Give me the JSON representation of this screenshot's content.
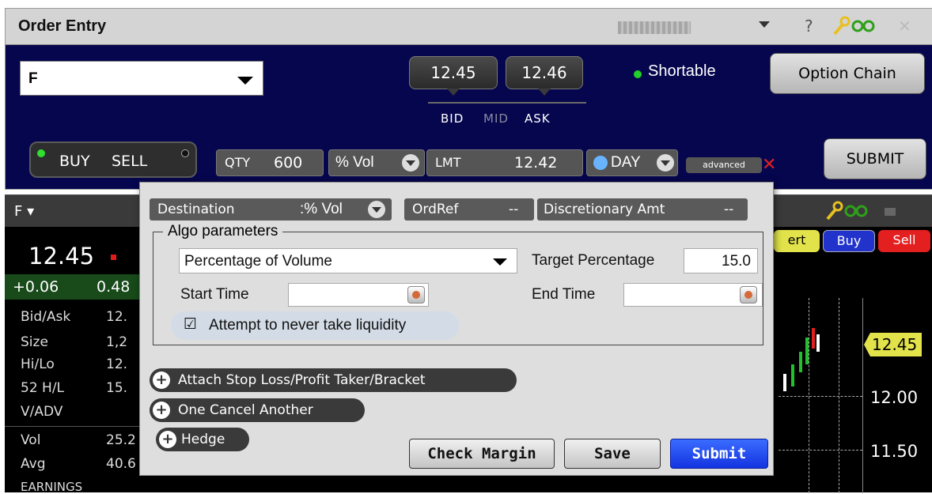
{
  "order_entry": {
    "title": "Order Entry",
    "symbol": "F",
    "bid": "12.45",
    "ask": "12.46",
    "bid_label": "BID",
    "mid_label": "MID",
    "ask_label": "ASK",
    "shortable": "Shortable",
    "option_chain": "Option Chain",
    "buy": "BUY",
    "sell": "SELL",
    "qty_label": "QTY",
    "qty_value": "600",
    "algo_type": "% Vol",
    "order_type": "LMT",
    "limit_price": "12.42",
    "tif": "DAY",
    "advanced": "advanced",
    "submit": "SUBMIT",
    "help": "?"
  },
  "quote_panel": {
    "symbol": "F",
    "last": "12.45",
    "change": "+0.06",
    "change_pct": "0.48",
    "rows": [
      {
        "label": "Bid/Ask",
        "value": "12."
      },
      {
        "label": "Size",
        "value": "1,2"
      },
      {
        "label": "Hi/Lo",
        "value": "12."
      },
      {
        "label": "52 H/L",
        "value": "15."
      },
      {
        "label": "V/ADV",
        "value": ""
      },
      {
        "label": "Vol",
        "value": "25.2"
      },
      {
        "label": "Avg",
        "value": "40.6"
      },
      {
        "label": "EARNINGS",
        "value": ""
      }
    ]
  },
  "chart": {
    "alert_partial": "ert",
    "buy": "Buy",
    "sell": "Sell",
    "last_tag": "12.45",
    "tick_12_00": "12.00",
    "tick_11_50": "11.50"
  },
  "advanced_panel": {
    "destination_label": "Destination",
    "destination_value": ":% Vol",
    "ordref_label": "OrdRef",
    "ordref_value": "--",
    "disc_label": "Discretionary Amt",
    "disc_value": "--",
    "algo_legend": "Algo parameters",
    "strategy": "Percentage of Volume",
    "target_pct_label": "Target Percentage",
    "target_pct_value": "15.0",
    "start_time_label": "Start Time",
    "end_time_label": "End Time",
    "never_take_liquidity": "Attempt to never take liquidity",
    "attach_bracket": "Attach Stop Loss/Profit Taker/Bracket",
    "oca": "One Cancel Another",
    "hedge": "Hedge",
    "check_margin": "Check Margin",
    "save": "Save",
    "submit": "Submit"
  },
  "colors": {
    "order_bg": "#06064e",
    "submit_blue": "#1846f0",
    "sell_red": "#e31f1f",
    "buy_blue": "#2233cc",
    "shortable_green": "#22d02a",
    "last_tag_yellow": "#e2e34a"
  }
}
